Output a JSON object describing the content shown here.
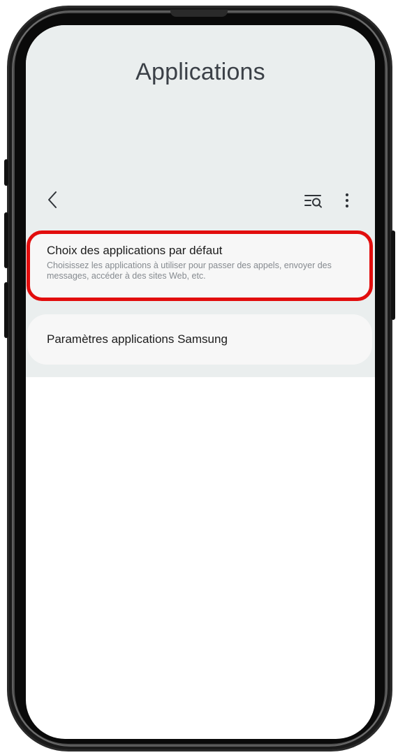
{
  "header": {
    "title": "Applications"
  },
  "toolbar": {
    "back_icon": "chevron-left-icon",
    "search_icon": "search-list-icon",
    "more_icon": "more-vertical-icon"
  },
  "items": [
    {
      "title": "Choix des applications par défaut",
      "subtitle": "Choisissez les applications à utiliser pour passer des appels, envoyer des messages, accéder à des sites Web, etc."
    },
    {
      "title": "Paramètres applications Samsung"
    }
  ],
  "colors": {
    "highlight": "#e20d0d",
    "background": "#eaeeee",
    "card": "#f7f7f7"
  }
}
